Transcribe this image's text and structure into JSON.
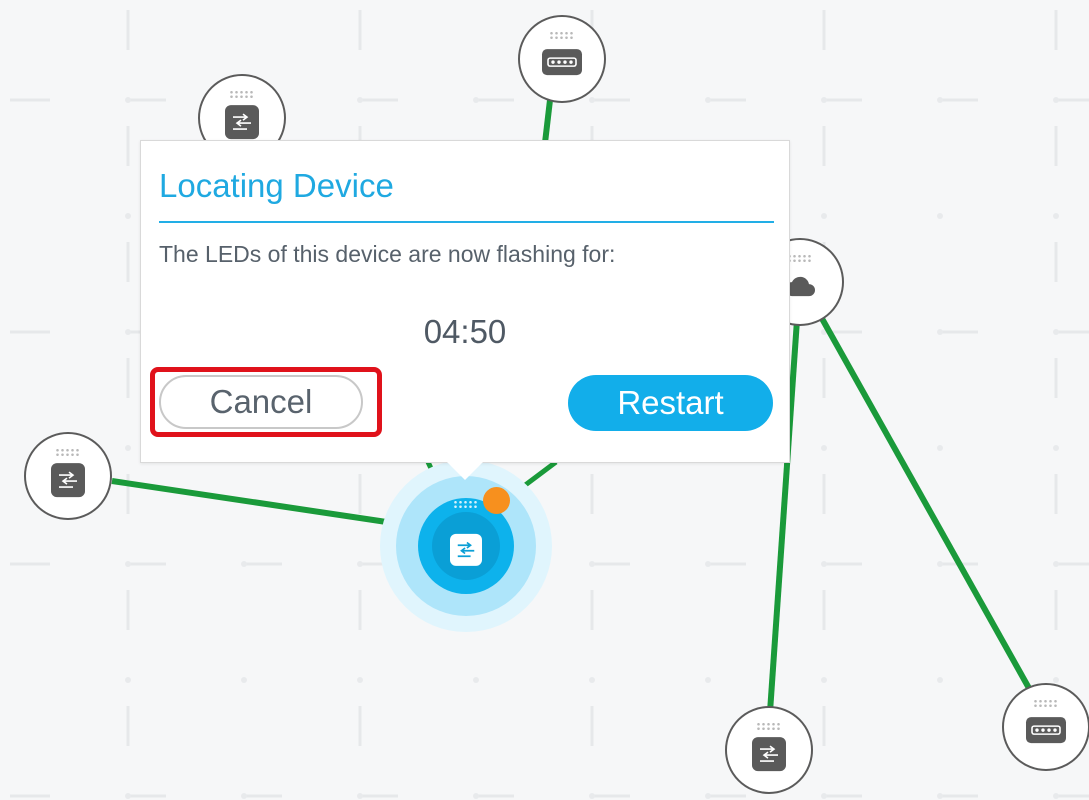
{
  "dialog": {
    "title": "Locating Device",
    "message": "The LEDs of this device are now flashing for:",
    "countdown": "04:50",
    "cancel_label": "Cancel",
    "restart_label": "Restart"
  },
  "topology": {
    "nodes": [
      {
        "id": "node-top",
        "type": "poe-switch",
        "icon": "ports-icon"
      },
      {
        "id": "node-upper-left",
        "type": "switch",
        "icon": "switch-icon"
      },
      {
        "id": "node-left",
        "type": "switch",
        "icon": "switch-icon"
      },
      {
        "id": "node-cloud",
        "type": "cloud",
        "icon": "cloud-icon"
      },
      {
        "id": "node-bottom-mid",
        "type": "switch",
        "icon": "switch-icon"
      },
      {
        "id": "node-bottom-right",
        "type": "poe-switch",
        "icon": "ports-icon"
      },
      {
        "id": "node-selected",
        "type": "switch",
        "icon": "switch-icon",
        "locating": true
      }
    ]
  },
  "colors": {
    "accent": "#1fa9e1",
    "link": "#1a9a3a",
    "highlight": "#e0121b",
    "status": "#f7901e"
  }
}
